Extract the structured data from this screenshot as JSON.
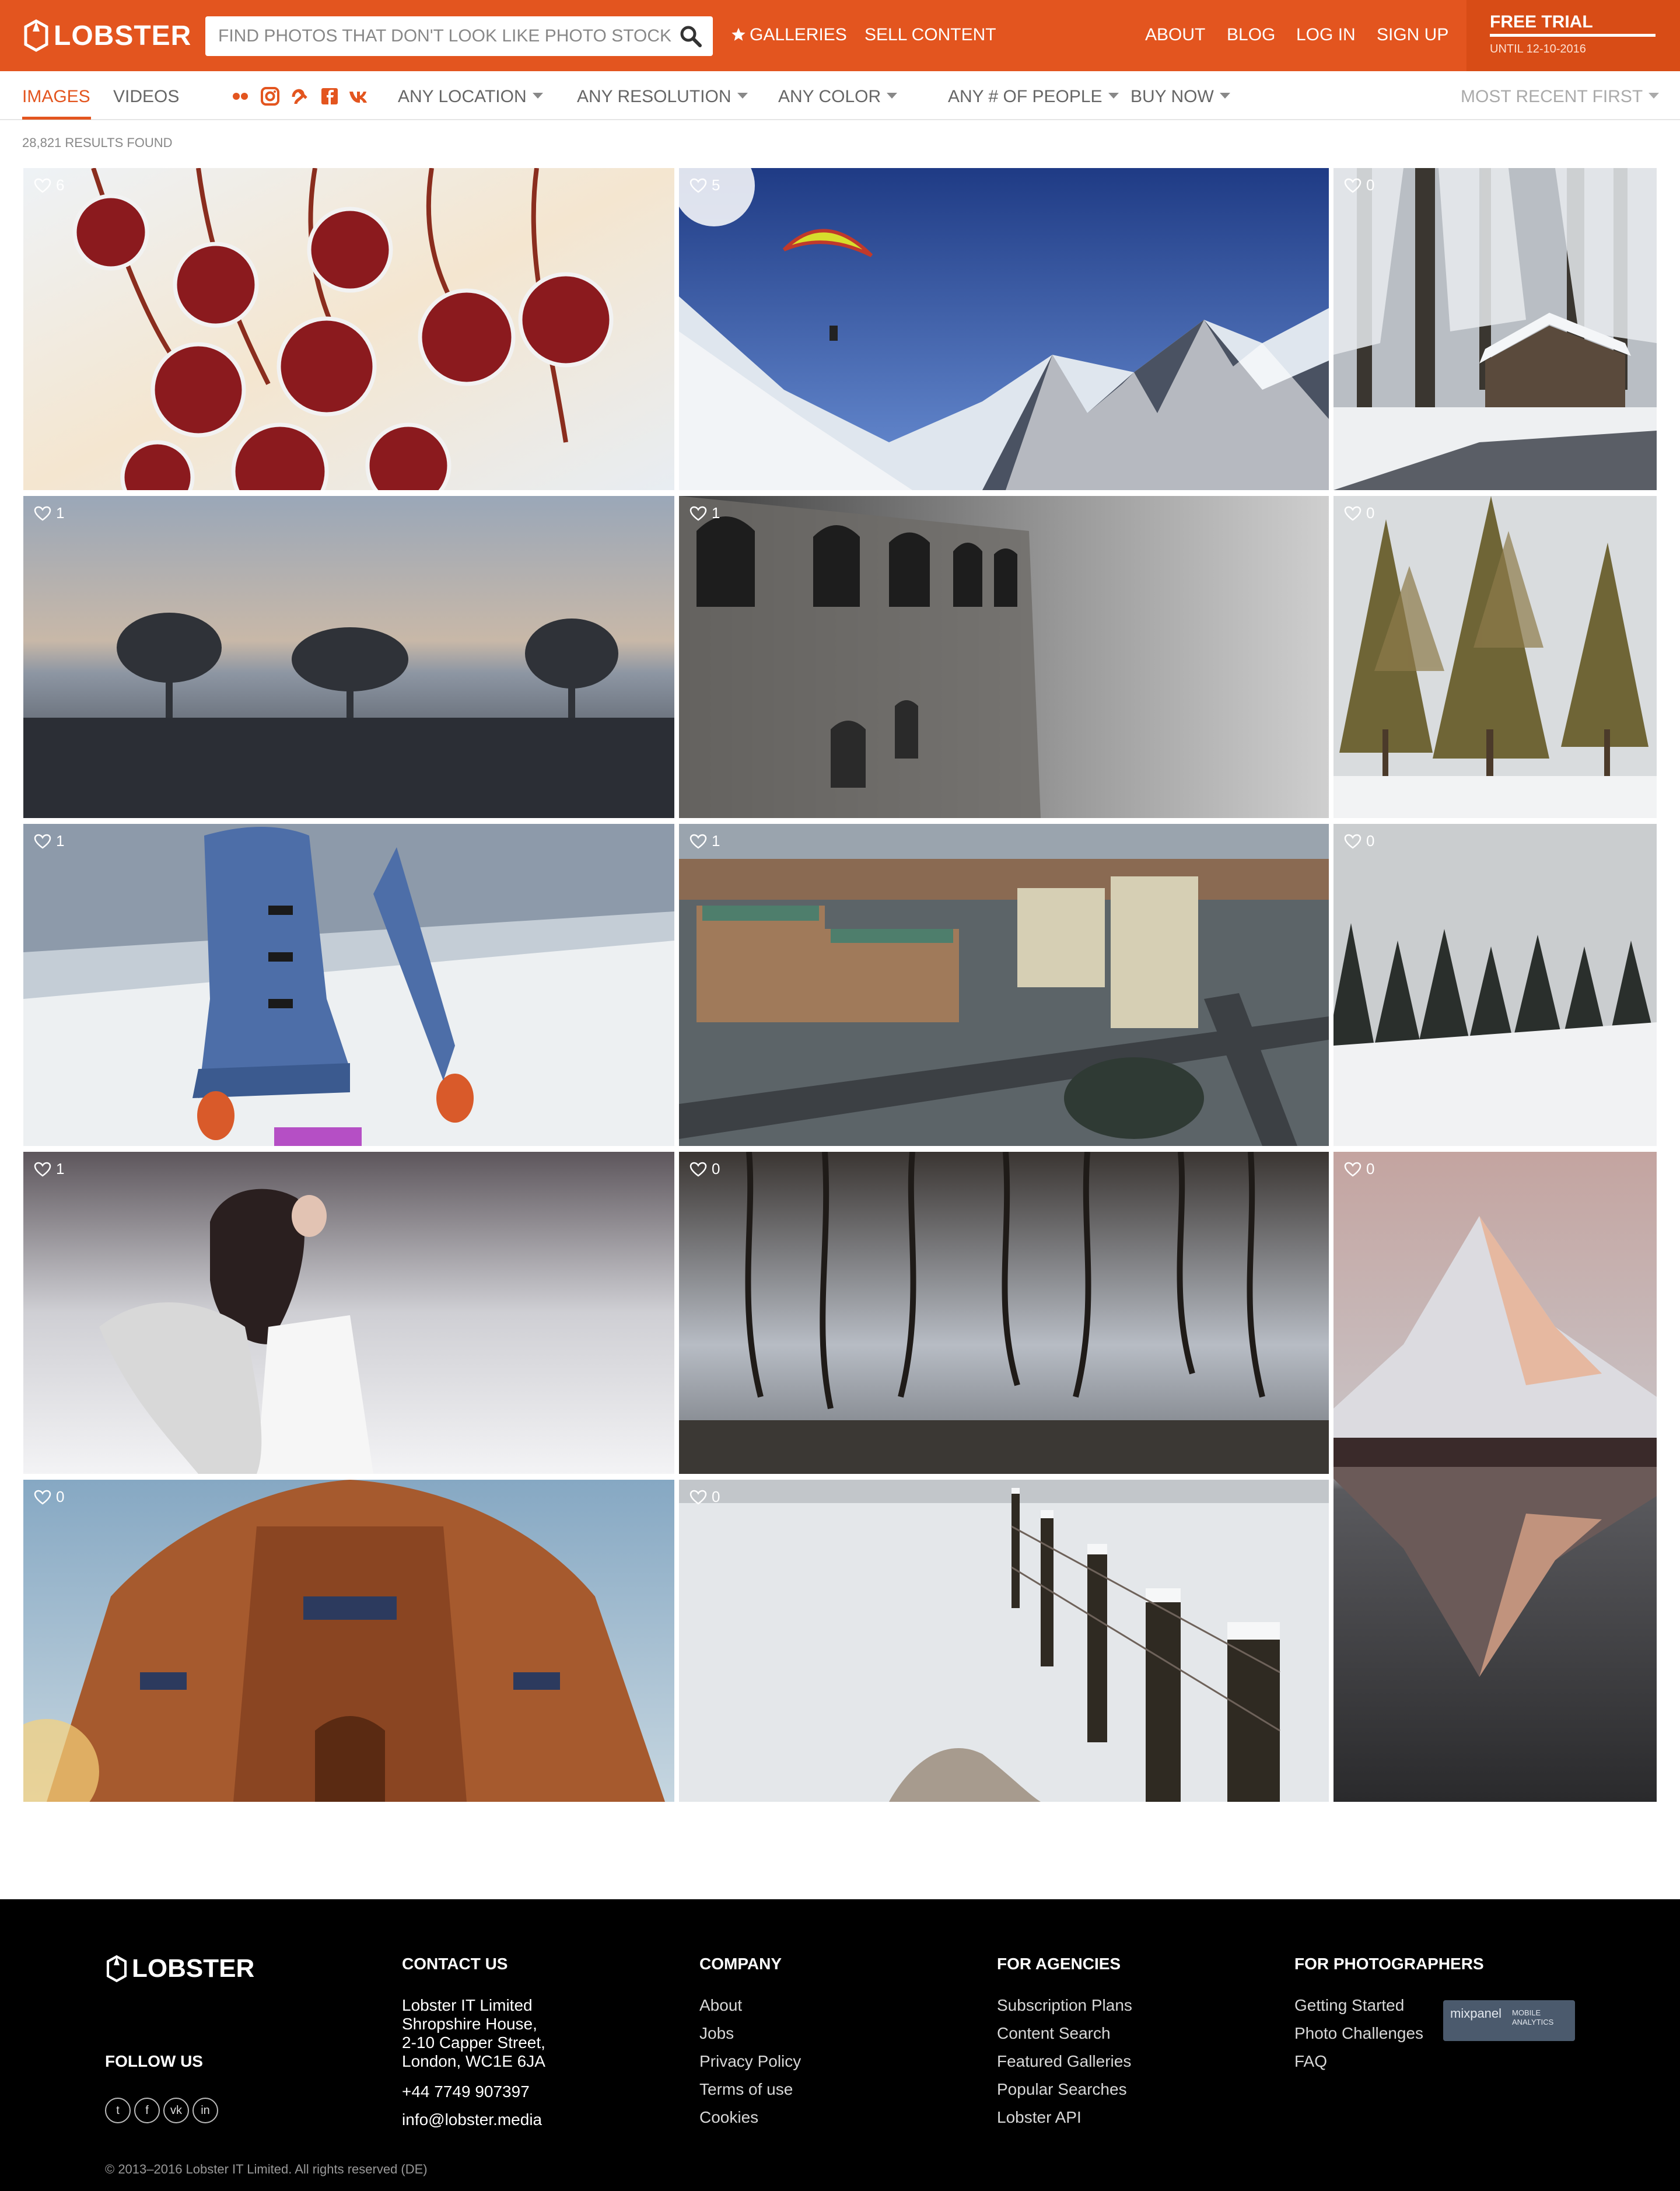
{
  "brand": {
    "name": "LOBSTER",
    "accent_color": "#e3551f"
  },
  "header": {
    "search_placeholder": "FIND PHOTOS THAT DON'T LOOK LIKE PHOTO STOCK",
    "nav": {
      "galleries": "GALLERIES",
      "sell": "SELL CONTENT",
      "about": "ABOUT",
      "blog": "BLOG",
      "login": "LOG IN",
      "signup": "SIGN UP"
    },
    "trial": {
      "title": "FREE TRIAL",
      "until": "UNTIL 12-10-2016"
    }
  },
  "filters": {
    "tabs": [
      "IMAGES",
      "VIDEOS"
    ],
    "active_tab": "IMAGES",
    "sources": [
      "flickr-icon",
      "instagram-icon",
      "px500-icon",
      "facebook-icon",
      "vk-icon"
    ],
    "dropdowns": [
      "ANY LOCATION",
      "ANY RESOLUTION",
      "ANY COLOR",
      "ANY # OF PEOPLE",
      "BUY NOW"
    ],
    "sort": "MOST RECENT FIRST"
  },
  "results_label": "28,821 RESULTS FOUND",
  "photos": [
    {
      "subject": "frosted red berries",
      "likes": "6"
    },
    {
      "subject": "paraglider over snowy mountains",
      "likes": "5"
    },
    {
      "subject": "snowy barn in pine forest",
      "likes": "0"
    },
    {
      "subject": "misty field with trees at sunset",
      "likes": "1"
    },
    {
      "subject": "foggy stone building facade",
      "likes": "1"
    },
    {
      "subject": "snow covered pine trees",
      "likes": "0"
    },
    {
      "subject": "person in blue coat in snow",
      "likes": "1"
    },
    {
      "subject": "aerial city view",
      "likes": "1"
    },
    {
      "subject": "snowy evergreen forest",
      "likes": "0"
    },
    {
      "subject": "woman with scarf in snowfall",
      "likes": "1"
    },
    {
      "subject": "trees reflected in water",
      "likes": "0"
    },
    {
      "subject": "mountain peak reflected in lake",
      "likes": "0"
    },
    {
      "subject": "ornate brick tomb at sunset",
      "likes": "0"
    },
    {
      "subject": "snowy fence posts",
      "likes": "0"
    }
  ],
  "footer": {
    "follow": "FOLLOW US",
    "socials": [
      "twitter-icon",
      "facebook-icon",
      "vk-icon",
      "linkedin-icon"
    ],
    "contact": {
      "heading": "CONTACT US",
      "company": "Lobster IT Limited",
      "addr1": "Shropshire House,",
      "addr2": "2-10 Capper Street,",
      "addr3": "London, WC1E 6JA",
      "phone": "+44 7749 907397",
      "email": "info@lobster.media"
    },
    "company": {
      "heading": "COMPANY",
      "links": [
        "About",
        "Jobs",
        "Privacy Policy",
        "Terms of use",
        "Cookies"
      ]
    },
    "agencies": {
      "heading": "FOR AGENCIES",
      "links": [
        "Subscription Plans",
        "Content Search",
        "Featured Galleries",
        "Popular Searches",
        "Lobster API"
      ]
    },
    "photographers": {
      "heading": "FOR PHOTOGRAPHERS",
      "links": [
        "Getting Started",
        "Photo Challenges",
        "FAQ"
      ]
    },
    "copyright": "© 2013–2016 Lobster IT Limited. All rights reserved (DE)",
    "badge": {
      "name": "mixpanel",
      "sub1": "MOBILE",
      "sub2": "ANALYTICS"
    }
  }
}
